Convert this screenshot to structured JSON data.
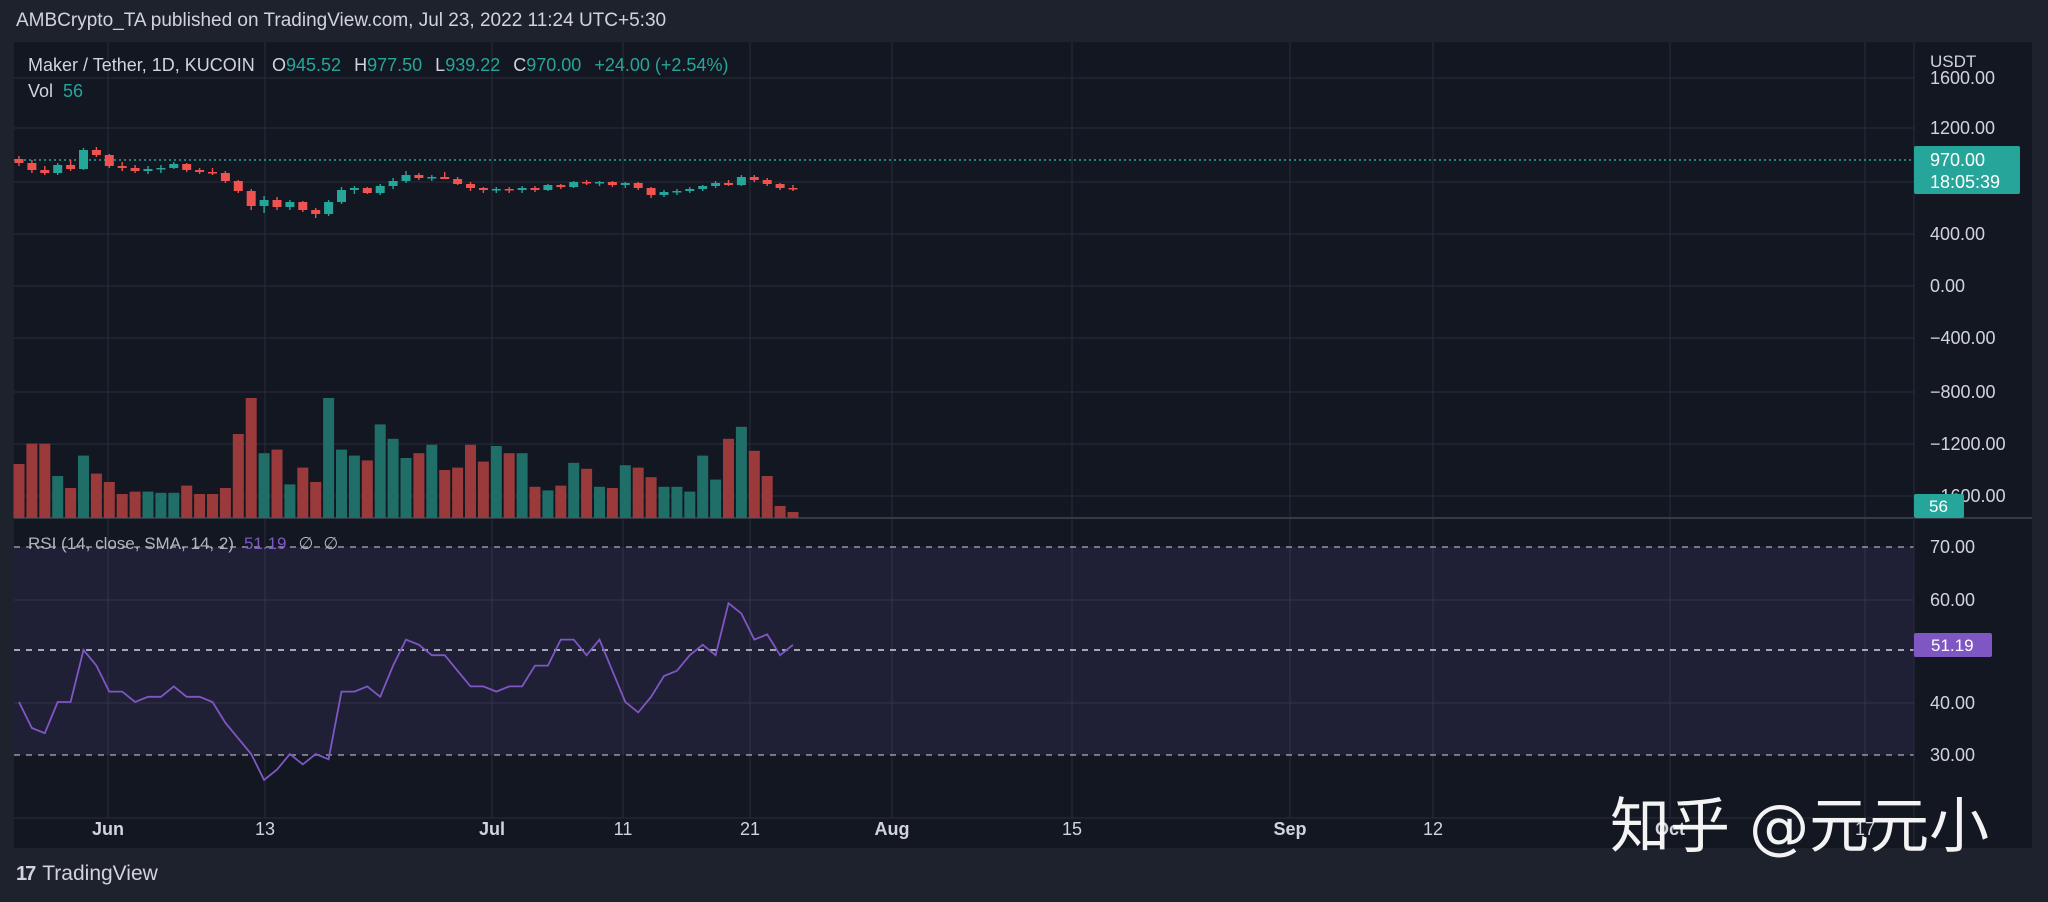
{
  "publish_line": "AMBCrypto_TA published on TradingView.com, Jul 23, 2022 11:24 UTC+5:30",
  "footer": {
    "brand": "TradingView",
    "brand_mark": "17"
  },
  "watermark": "知乎 @元元小",
  "colors": {
    "up": "#26a69a",
    "down": "#ef5350",
    "vol_up": "#1f6e68",
    "vol_down": "#9b3a3b",
    "rsi": "#7e57c2",
    "bg": "#131722",
    "frame": "#1e222d",
    "grid": "#2a2e39",
    "text": "#d1d4dc"
  },
  "legend": {
    "symbol": "Maker / Tether, 1D, KUCOIN",
    "o_label": "O",
    "o_value": "945.52",
    "h_label": "H",
    "h_value": "977.50",
    "l_label": "L",
    "l_value": "939.22",
    "c_label": "C",
    "c_value": "970.00",
    "change": "+24.00 (+2.54%)",
    "vol_label": "Vol",
    "vol_value": "56",
    "rsi_label": "RSI (14, close, SMA, 14, 2)",
    "rsi_value": "51.19",
    "rsi_na1": "∅",
    "rsi_na2": "∅"
  },
  "chart_data": [
    {
      "type": "candlestick",
      "title": "Maker / Tether, 1D, KUCOIN",
      "y_unit": "USDT",
      "y_ticks": [
        "1600.00",
        "1200.00",
        "400.00",
        "0.00",
        "−400.00",
        "−800.00",
        "−1200.00",
        "−1600.00"
      ],
      "last_price": "970.00",
      "countdown": "18:05:39",
      "x_ticks": [
        "Jun",
        "13",
        "Jul",
        "11",
        "21",
        "Aug",
        "15",
        "Sep",
        "12",
        "Oct",
        "17"
      ],
      "candles": [
        {
          "o": 1270,
          "h": 1300,
          "l": 1200,
          "c": 1230
        },
        {
          "o": 1230,
          "h": 1260,
          "l": 1130,
          "c": 1160
        },
        {
          "o": 1160,
          "h": 1200,
          "l": 1110,
          "c": 1130
        },
        {
          "o": 1130,
          "h": 1230,
          "l": 1110,
          "c": 1210
        },
        {
          "o": 1210,
          "h": 1260,
          "l": 1150,
          "c": 1170
        },
        {
          "o": 1170,
          "h": 1380,
          "l": 1160,
          "c": 1360
        },
        {
          "o": 1360,
          "h": 1390,
          "l": 1290,
          "c": 1310
        },
        {
          "o": 1310,
          "h": 1320,
          "l": 1180,
          "c": 1200
        },
        {
          "o": 1200,
          "h": 1240,
          "l": 1150,
          "c": 1180
        },
        {
          "o": 1180,
          "h": 1210,
          "l": 1130,
          "c": 1150
        },
        {
          "o": 1150,
          "h": 1200,
          "l": 1120,
          "c": 1170
        },
        {
          "o": 1170,
          "h": 1210,
          "l": 1130,
          "c": 1180
        },
        {
          "o": 1180,
          "h": 1240,
          "l": 1170,
          "c": 1220
        },
        {
          "o": 1220,
          "h": 1230,
          "l": 1140,
          "c": 1160
        },
        {
          "o": 1160,
          "h": 1180,
          "l": 1120,
          "c": 1140
        },
        {
          "o": 1140,
          "h": 1180,
          "l": 1110,
          "c": 1130
        },
        {
          "o": 1130,
          "h": 1150,
          "l": 1030,
          "c": 1050
        },
        {
          "o": 1050,
          "h": 1060,
          "l": 930,
          "c": 950
        },
        {
          "o": 950,
          "h": 970,
          "l": 760,
          "c": 800
        },
        {
          "o": 800,
          "h": 900,
          "l": 730,
          "c": 860
        },
        {
          "o": 860,
          "h": 890,
          "l": 760,
          "c": 790
        },
        {
          "o": 790,
          "h": 860,
          "l": 760,
          "c": 840
        },
        {
          "o": 840,
          "h": 850,
          "l": 740,
          "c": 760
        },
        {
          "o": 760,
          "h": 780,
          "l": 680,
          "c": 720
        },
        {
          "o": 720,
          "h": 860,
          "l": 700,
          "c": 840
        },
        {
          "o": 840,
          "h": 990,
          "l": 820,
          "c": 960
        },
        {
          "o": 960,
          "h": 1000,
          "l": 920,
          "c": 980
        },
        {
          "o": 980,
          "h": 990,
          "l": 920,
          "c": 930
        },
        {
          "o": 930,
          "h": 1020,
          "l": 910,
          "c": 1000
        },
        {
          "o": 1000,
          "h": 1080,
          "l": 970,
          "c": 1050
        },
        {
          "o": 1050,
          "h": 1150,
          "l": 1030,
          "c": 1110
        },
        {
          "o": 1110,
          "h": 1130,
          "l": 1060,
          "c": 1080
        },
        {
          "o": 1080,
          "h": 1110,
          "l": 1050,
          "c": 1090
        },
        {
          "o": 1090,
          "h": 1140,
          "l": 1070,
          "c": 1070
        },
        {
          "o": 1070,
          "h": 1090,
          "l": 1010,
          "c": 1020
        },
        {
          "o": 1020,
          "h": 1040,
          "l": 950,
          "c": 980
        },
        {
          "o": 980,
          "h": 990,
          "l": 930,
          "c": 960
        },
        {
          "o": 960,
          "h": 990,
          "l": 930,
          "c": 970
        },
        {
          "o": 970,
          "h": 990,
          "l": 930,
          "c": 960
        },
        {
          "o": 960,
          "h": 1000,
          "l": 930,
          "c": 980
        },
        {
          "o": 980,
          "h": 1000,
          "l": 940,
          "c": 960
        },
        {
          "o": 960,
          "h": 1020,
          "l": 950,
          "c": 1010
        },
        {
          "o": 1010,
          "h": 1020,
          "l": 970,
          "c": 990
        },
        {
          "o": 990,
          "h": 1050,
          "l": 980,
          "c": 1040
        },
        {
          "o": 1040,
          "h": 1060,
          "l": 1010,
          "c": 1030
        },
        {
          "o": 1030,
          "h": 1050,
          "l": 1000,
          "c": 1040
        },
        {
          "o": 1040,
          "h": 1050,
          "l": 990,
          "c": 1010
        },
        {
          "o": 1010,
          "h": 1040,
          "l": 980,
          "c": 1030
        },
        {
          "o": 1030,
          "h": 1040,
          "l": 960,
          "c": 980
        },
        {
          "o": 980,
          "h": 990,
          "l": 880,
          "c": 910
        },
        {
          "o": 910,
          "h": 960,
          "l": 890,
          "c": 940
        },
        {
          "o": 940,
          "h": 970,
          "l": 910,
          "c": 950
        },
        {
          "o": 950,
          "h": 990,
          "l": 930,
          "c": 970
        },
        {
          "o": 970,
          "h": 1010,
          "l": 950,
          "c": 1000
        },
        {
          "o": 1000,
          "h": 1050,
          "l": 980,
          "c": 1030
        },
        {
          "o": 1030,
          "h": 1060,
          "l": 1000,
          "c": 1010
        },
        {
          "o": 1010,
          "h": 1110,
          "l": 1000,
          "c": 1090
        },
        {
          "o": 1090,
          "h": 1110,
          "l": 1040,
          "c": 1060
        },
        {
          "o": 1060,
          "h": 1080,
          "l": 1000,
          "c": 1020
        },
        {
          "o": 1020,
          "h": 1030,
          "l": 960,
          "c": 980
        },
        {
          "o": 980,
          "h": 1010,
          "l": 950,
          "c": 970
        }
      ]
    },
    {
      "type": "bar",
      "title": "Vol",
      "last_value": "56",
      "values": [
        45,
        62,
        62,
        35,
        25,
        52,
        37,
        30,
        20,
        22,
        22,
        21,
        21,
        27,
        20,
        20,
        25,
        70,
        100,
        54,
        57,
        28,
        42,
        30,
        100,
        57,
        52,
        48,
        78,
        66,
        50,
        54,
        61,
        40,
        42,
        61,
        47,
        60,
        54,
        54,
        26,
        23,
        27,
        46,
        41,
        26,
        25,
        44,
        42,
        34,
        26,
        26,
        22,
        52,
        32,
        66,
        76,
        56,
        35,
        10,
        5
      ]
    },
    {
      "type": "line",
      "title": "RSI (14, close, SMA, 14, 2)",
      "last_value": "51.19",
      "y_ticks": [
        "70.00",
        "60.00",
        "40.00",
        "30.00"
      ],
      "band": [
        30,
        70
      ],
      "midline": 50,
      "values": [
        40,
        35,
        34,
        40,
        40,
        50,
        47,
        42,
        42,
        40,
        41,
        41,
        43,
        41,
        41,
        40,
        36,
        33,
        30,
        25,
        27,
        30,
        28,
        30,
        29,
        42,
        42,
        43,
        41,
        47,
        52,
        51,
        49,
        49,
        46,
        43,
        43,
        42,
        43,
        43,
        47,
        47,
        52,
        52,
        49,
        52,
        46,
        40,
        38,
        41,
        45,
        46,
        49,
        51,
        49,
        59,
        57,
        52,
        53,
        49,
        51
      ]
    }
  ]
}
